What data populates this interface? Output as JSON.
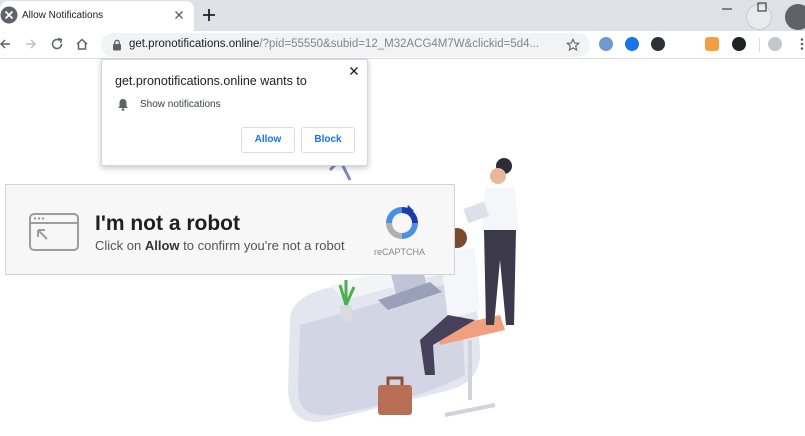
{
  "tab": {
    "title": "Allow Notifications",
    "new_tab_symbol": "+"
  },
  "toolbar": {
    "url_host": "get.pronotifications.online",
    "url_path": "/?pid=55550&subid=12_M32ACG4M7W&clickid=5d4...",
    "extensions": [
      "shield-ext-icon",
      "search-ext-icon",
      "dark-ext-icon",
      "bird-ext-icon",
      "pen-ext-icon",
      "profile-icon",
      "menu-icon"
    ]
  },
  "notification": {
    "title": "get.pronotifications.online wants to",
    "permission": "Show notifications",
    "allow_label": "Allow",
    "block_label": "Block"
  },
  "captcha": {
    "title": "I'm not a robot",
    "sub_prefix": "Click on ",
    "sub_bold": "Allow",
    "sub_suffix": " to confirm you're not a robot",
    "brand": "reCAPTCHA"
  },
  "colors": {
    "accent": "#1a73e8",
    "tabstrip": "#dee1e6",
    "captcha_bg": "#f7f7f7"
  }
}
